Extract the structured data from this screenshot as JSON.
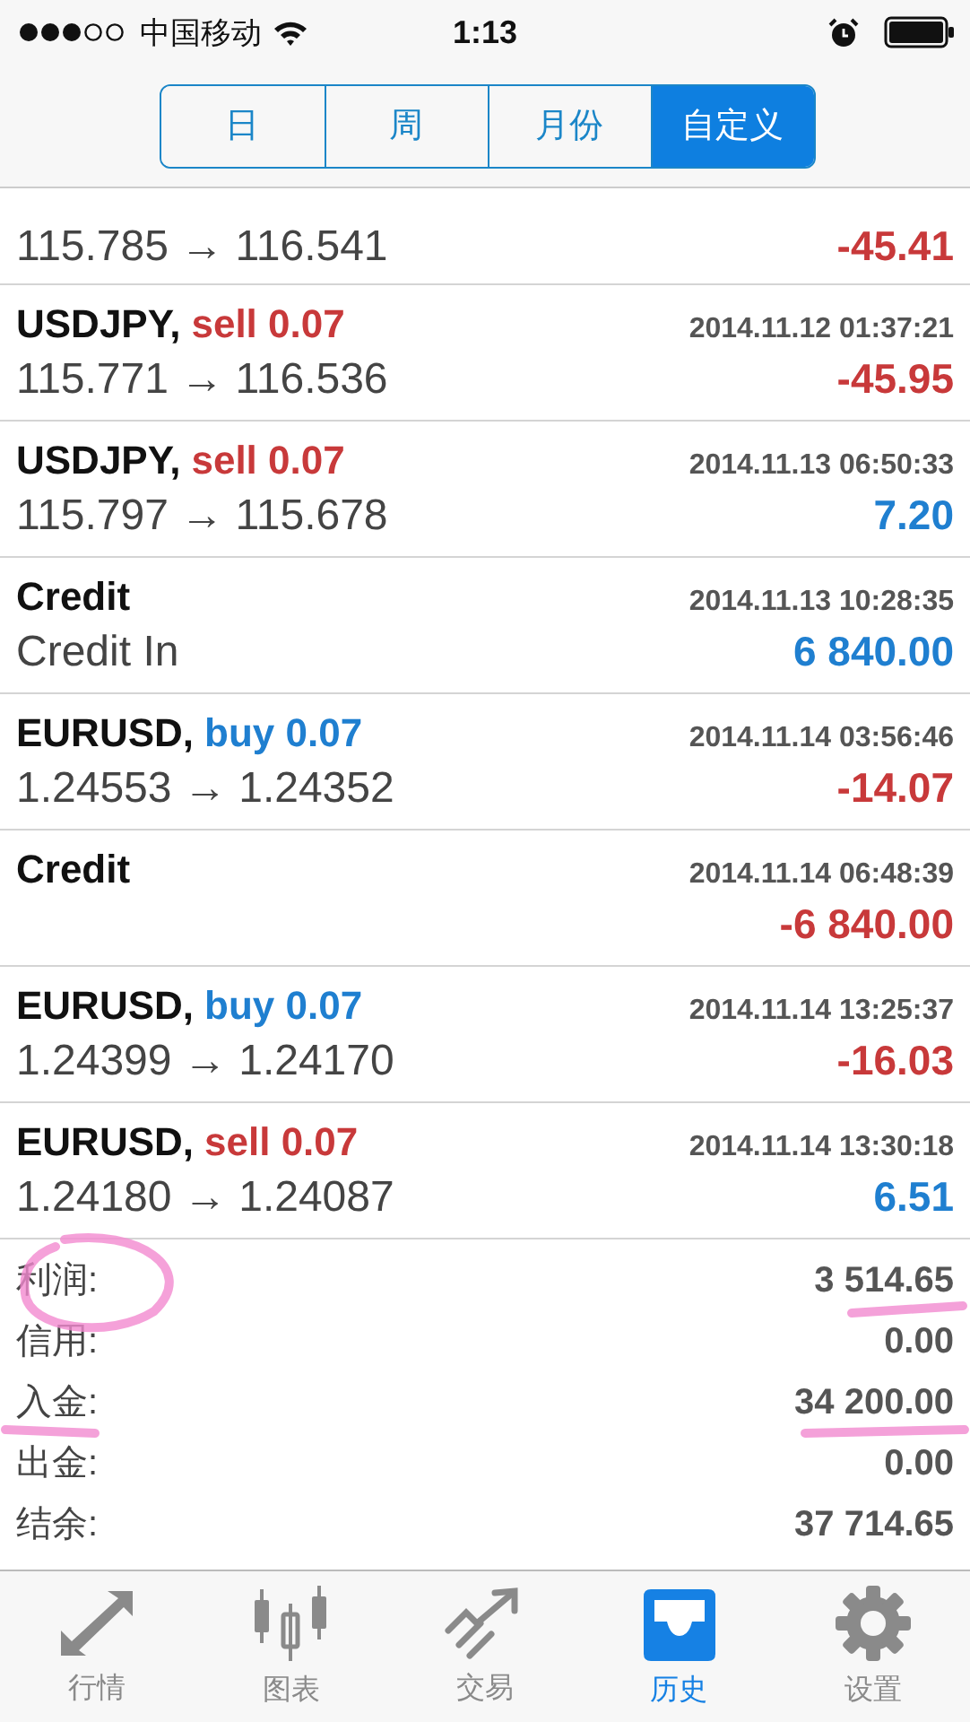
{
  "status_bar": {
    "carrier": "中国移动",
    "time": "1:13"
  },
  "period_tabs": [
    {
      "label": "日",
      "selected": false
    },
    {
      "label": "周",
      "selected": false
    },
    {
      "label": "月份",
      "selected": false
    },
    {
      "label": "自定义",
      "selected": true
    }
  ],
  "deals": [
    {
      "prices": "115.785 → 116.541",
      "profit": "-45.41",
      "loss": true
    },
    {
      "kind": "sell",
      "symbol": "USDJPY,",
      "order": "sell 0.07",
      "time": "2014.11.12 01:37:21",
      "prices": "115.771 → 116.536",
      "profit": "-45.95",
      "loss": true
    },
    {
      "kind": "sell",
      "symbol": "USDJPY,",
      "order": "sell 0.07",
      "time": "2014.11.13 06:50:33",
      "prices": "115.797 → 115.678",
      "profit": "7.20",
      "loss": false
    },
    {
      "symbol": "Credit",
      "time": "2014.11.13 10:28:35",
      "prices": "Credit In",
      "profit": "6 840.00",
      "loss": false
    },
    {
      "kind": "buy",
      "symbol": "EURUSD,",
      "order": "buy 0.07",
      "time": "2014.11.14 03:56:46",
      "prices": "1.24553 → 1.24352",
      "profit": "-14.07",
      "loss": true
    },
    {
      "symbol": "Credit",
      "time": "2014.11.14 06:48:39",
      "profit": "-6 840.00",
      "loss": true
    },
    {
      "kind": "buy",
      "symbol": "EURUSD,",
      "order": "buy 0.07",
      "time": "2014.11.14 13:25:37",
      "prices": "1.24399 → 1.24170",
      "profit": "-16.03",
      "loss": true
    },
    {
      "kind": "sell",
      "symbol": "EURUSD,",
      "order": "sell 0.07",
      "time": "2014.11.14 13:30:18",
      "prices": "1.24180 → 1.24087",
      "profit": "6.51",
      "loss": false
    }
  ],
  "summary": [
    {
      "label": "利润:",
      "value": "3 514.65"
    },
    {
      "label": "信用:",
      "value": "0.00"
    },
    {
      "label": "入金:",
      "value": "34 200.00"
    },
    {
      "label": "出金:",
      "value": "0.00"
    },
    {
      "label": "结余:",
      "value": "37 714.65"
    }
  ],
  "bottom_tabs": [
    {
      "label": "行情",
      "kind": "quotes",
      "selected": false
    },
    {
      "label": "图表",
      "kind": "chart",
      "selected": false
    },
    {
      "label": "交易",
      "kind": "trade",
      "selected": false
    },
    {
      "label": "历史",
      "kind": "history",
      "selected": true
    },
    {
      "label": "设置",
      "kind": "settings",
      "selected": false
    }
  ]
}
